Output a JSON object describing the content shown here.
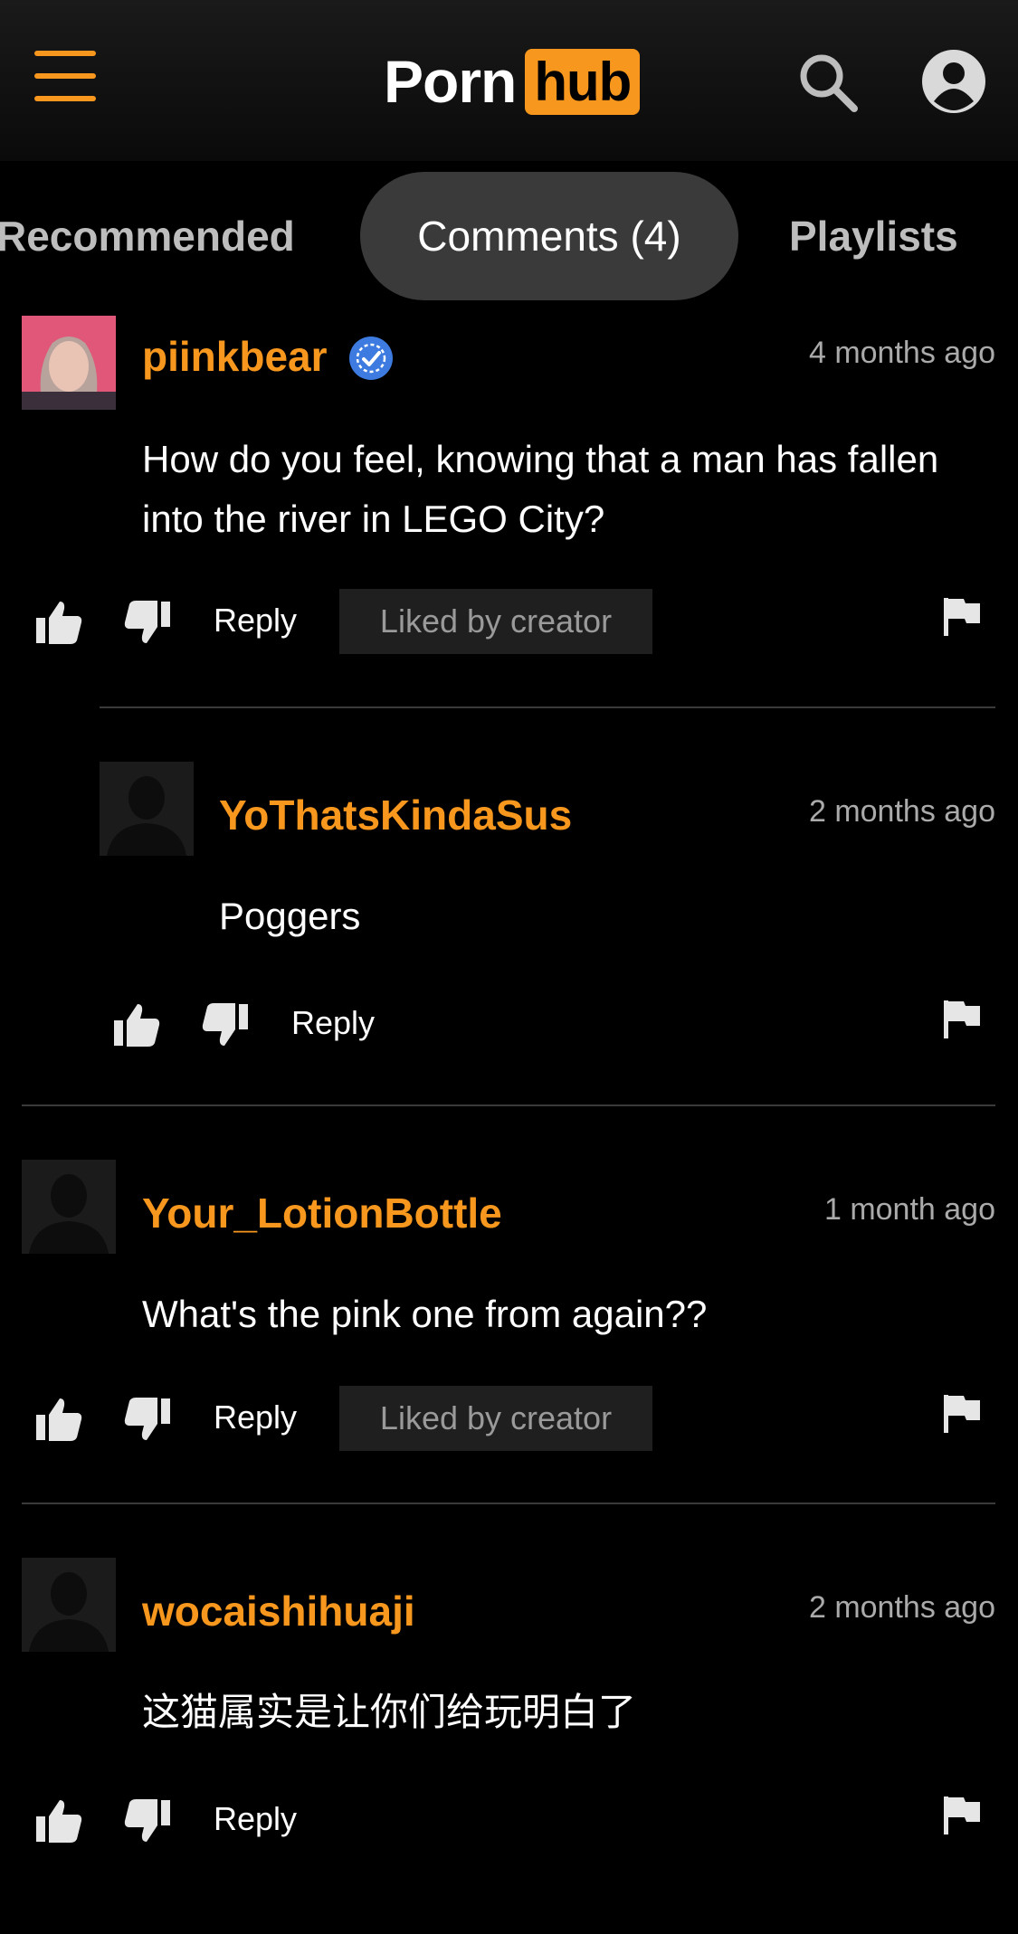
{
  "header": {
    "logo_porn": "Porn",
    "logo_hub": "hub",
    "menu_icon": "hamburger-menu-icon",
    "search_icon": "search-icon",
    "account_icon": "account-icon"
  },
  "tabs": [
    {
      "label": "Recommended",
      "active": false
    },
    {
      "label": "Comments (4)",
      "active": true
    },
    {
      "label": "Playlists",
      "active": false
    }
  ],
  "comments": [
    {
      "username": "piinkbear",
      "verified": true,
      "time": "4 months ago",
      "text": "How do you feel, knowing that a man has fallen into the river in LEGO City?",
      "reply_label": "Reply",
      "badge": "Liked by creator"
    },
    {
      "username": "YoThatsKindaSus",
      "verified": false,
      "time": "2 months ago",
      "text": "Poggers",
      "reply_label": "Reply",
      "is_reply": true
    },
    {
      "username": "Your_LotionBottle",
      "verified": false,
      "time": "1 month ago",
      "text": "What's the pink one from again??",
      "reply_label": "Reply",
      "badge": "Liked by creator"
    },
    {
      "username": "wocaishihuaji",
      "verified": false,
      "time": "2 months ago",
      "text": "这猫属实是让你们给玩明白了",
      "reply_label": "Reply"
    }
  ],
  "colors": {
    "accent": "#f7971d",
    "background": "#000000",
    "active_tab": "#3a3a3a",
    "verified": "#3d7be0"
  }
}
